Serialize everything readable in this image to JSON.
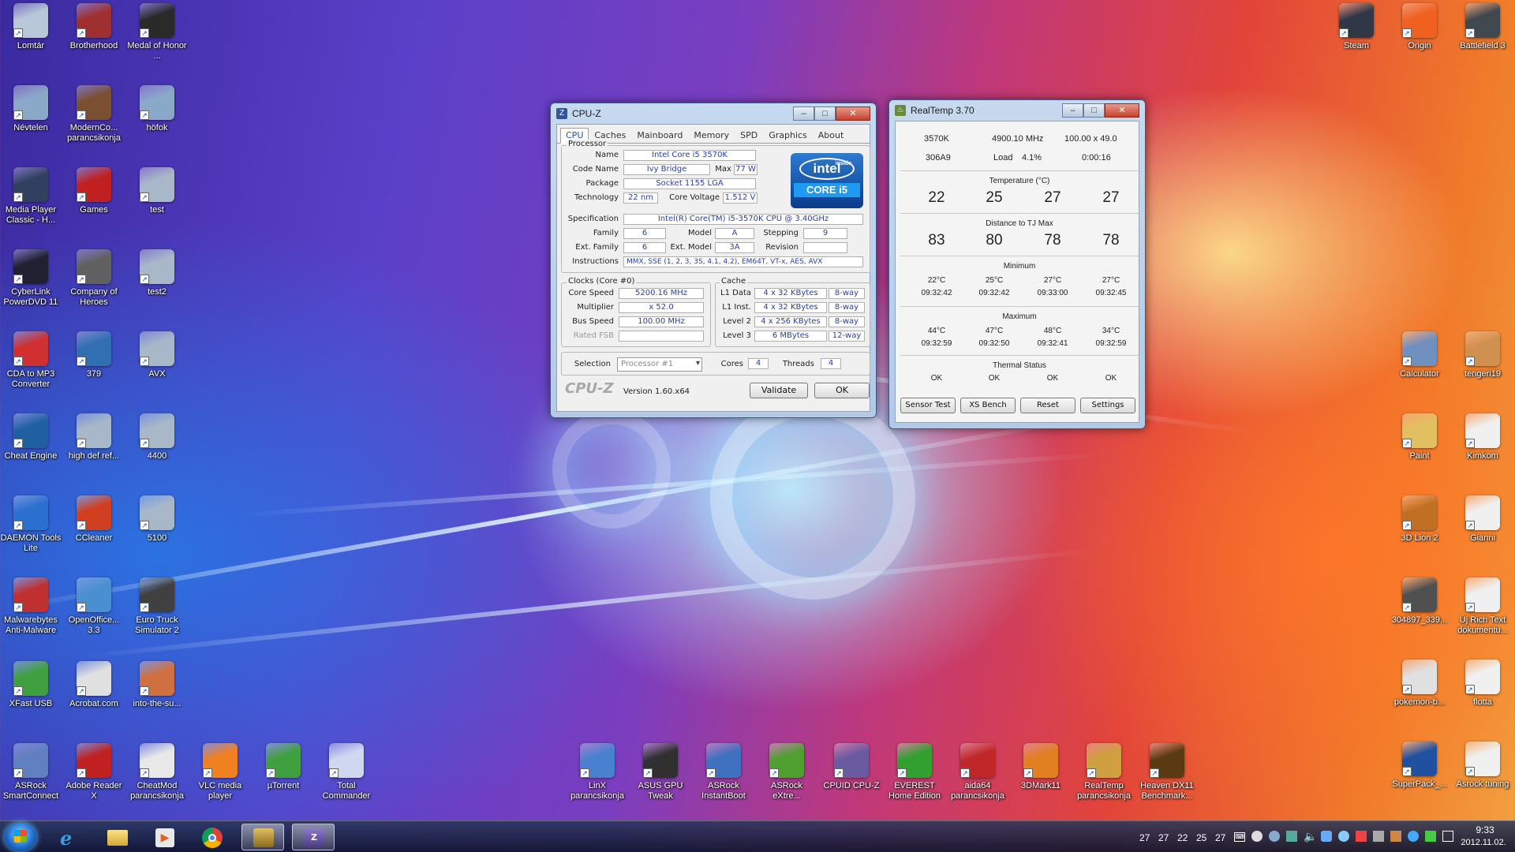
{
  "desktop": {
    "icons_left": [
      {
        "label": "Lomtár",
        "icon": "recycle-bin-icon",
        "color": "#b8c8d8"
      },
      {
        "label": "Brotherhood",
        "icon": "game-icon",
        "color": "#a03030"
      },
      {
        "label": "Medal of Honor ...",
        "icon": "medal-of-honor-icon",
        "color": "#2a2a2a"
      },
      {
        "label": "Névtelen",
        "icon": "image-file-icon",
        "color": "#8aa8c8"
      },
      {
        "label": "ModernCo... parancsikonja",
        "icon": "game-icon",
        "color": "#7a5030"
      },
      {
        "label": "höfok",
        "icon": "image-file-icon",
        "color": "#8aa8c8"
      },
      {
        "label": "Media Player Classic - H...",
        "icon": "media-player-icon",
        "color": "#304060"
      },
      {
        "label": "Games",
        "icon": "games-icon",
        "color": "#c02020"
      },
      {
        "label": "test",
        "icon": "image-file-icon",
        "color": "#a8b8c8"
      },
      {
        "label": "CyberLink PowerDVD 11",
        "icon": "powerdvd-icon",
        "color": "#202030"
      },
      {
        "label": "Company of Heroes",
        "icon": "game-icon",
        "color": "#606060"
      },
      {
        "label": "test2",
        "icon": "image-file-icon",
        "color": "#a8b8c8"
      },
      {
        "label": "CDA to MP3 Converter",
        "icon": "audio-converter-icon",
        "color": "#d03030"
      },
      {
        "label": "379",
        "icon": "image-file-icon",
        "color": "#3070b0"
      },
      {
        "label": "AVX",
        "icon": "image-file-icon",
        "color": "#a8b8c8"
      },
      {
        "label": "Cheat Engine",
        "icon": "cheat-engine-icon",
        "color": "#2060a0"
      },
      {
        "label": "high def ref...",
        "icon": "image-file-icon",
        "color": "#a8b8c8"
      },
      {
        "label": "4400",
        "icon": "image-file-icon",
        "color": "#a8b8c8"
      },
      {
        "label": "DAEMON Tools Lite",
        "icon": "daemon-tools-icon",
        "color": "#2a70d0"
      },
      {
        "label": "CCleaner",
        "icon": "ccleaner-icon",
        "color": "#d04020"
      },
      {
        "label": "5100",
        "icon": "image-file-icon",
        "color": "#a8b8c8"
      },
      {
        "label": "Malwarebytes Anti-Malware",
        "icon": "malwarebytes-icon",
        "color": "#c03030"
      },
      {
        "label": "OpenOffice... 3.3",
        "icon": "openoffice-icon",
        "color": "#4a90d0"
      },
      {
        "label": "Euro Truck Simulator 2",
        "icon": "truck-icon",
        "color": "#404040"
      },
      {
        "label": "XFast USB",
        "icon": "usb-icon",
        "color": "#40a040"
      },
      {
        "label": "Acrobat.com",
        "icon": "acrobat-icon",
        "color": "#e0e0e0"
      },
      {
        "label": "into-the-su...",
        "icon": "image-file-icon",
        "color": "#d07040"
      },
      {
        "label": "ASRock SmartConnect",
        "icon": "asrock-icon",
        "color": "#6080c0"
      },
      {
        "label": "Adobe Reader X",
        "icon": "adobe-reader-icon",
        "color": "#c02020"
      },
      {
        "label": "CheatMod parancsikonja",
        "icon": "document-icon",
        "color": "#e8e8e8"
      },
      {
        "label": "VLC media player",
        "icon": "vlc-icon",
        "color": "#f08020"
      },
      {
        "label": "µTorrent",
        "icon": "utorrent-icon",
        "color": "#40a040"
      },
      {
        "label": "Total Commander",
        "icon": "total-commander-icon",
        "color": "#d0d8f0"
      }
    ],
    "icons_bottom": [
      {
        "label": "LinX parancsikonja",
        "icon": "linx-icon",
        "color": "#4a80d0"
      },
      {
        "label": "ASUS GPU Tweak",
        "icon": "gpu-tweak-icon",
        "color": "#303030"
      },
      {
        "label": "ASRock InstantBoot",
        "icon": "asrock-icon",
        "color": "#4070c0"
      },
      {
        "label": "ASRock eXtre...",
        "icon": "asrock-icon",
        "color": "#50a030"
      },
      {
        "label": "CPUID CPU-Z",
        "icon": "cpuz-icon",
        "color": "#6a5aa0"
      },
      {
        "label": "EVEREST Home Edition",
        "icon": "everest-icon",
        "color": "#30a030"
      },
      {
        "label": "aida64 parancsikonja",
        "icon": "aida64-icon",
        "color": "#c02828"
      },
      {
        "label": "3DMark11",
        "icon": "3dmark-icon",
        "color": "#e08020"
      },
      {
        "label": "RealTemp parancsikonja",
        "icon": "realtemp-icon",
        "color": "#d0a040"
      },
      {
        "label": "Heaven DX11 Benchmark...",
        "icon": "heaven-icon",
        "color": "#5a3a10"
      }
    ],
    "icons_right_top": [
      {
        "label": "Steam",
        "icon": "steam-icon",
        "color": "#303848"
      },
      {
        "label": "Origin",
        "icon": "origin-icon",
        "color": "#f06020"
      },
      {
        "label": "Battlefield 3",
        "icon": "battlefield-icon",
        "color": "#404850"
      }
    ],
    "icons_right": [
      {
        "label": "Calculator",
        "icon": "calculator-icon",
        "color": "#7090c0"
      },
      {
        "label": "tengeri19",
        "icon": "image-file-icon",
        "color": "#d09050"
      },
      {
        "label": "Paint",
        "icon": "paint-icon",
        "color": "#e0c060"
      },
      {
        "label": "Kimkom",
        "icon": "text-file-icon",
        "color": "#f0f0f0"
      },
      {
        "label": "3D Lion 2",
        "icon": "image-file-icon",
        "color": "#c07020"
      },
      {
        "label": "Gianni",
        "icon": "text-file-icon",
        "color": "#f0f0f0"
      },
      {
        "label": "304897_339...",
        "icon": "image-file-icon",
        "color": "#505050"
      },
      {
        "label": "Új Rich Text dokumentu...",
        "icon": "text-file-icon",
        "color": "#f0f0f0"
      },
      {
        "label": "pokemon-b...",
        "icon": "image-file-icon",
        "color": "#e0e0e0"
      },
      {
        "label": "flotta",
        "icon": "text-file-icon",
        "color": "#f0f0f0"
      },
      {
        "label": "SuperPack_...",
        "icon": "image-file-icon",
        "color": "#2050a0"
      },
      {
        "label": "Asrock tuning",
        "icon": "text-file-icon",
        "color": "#f0f0f0"
      }
    ]
  },
  "cpuz": {
    "title": "CPU-Z",
    "tabs": [
      "CPU",
      "Caches",
      "Mainboard",
      "Memory",
      "SPD",
      "Graphics",
      "About"
    ],
    "processor_group": "Processor",
    "name_label": "Name",
    "name": "Intel Core i5 3570K",
    "codename_label": "Code Name",
    "codename": "Ivy Bridge",
    "maxtdp_label": "Max TDP",
    "maxtdp": "77 W",
    "package_label": "Package",
    "package": "Socket 1155 LGA",
    "technology_label": "Technology",
    "technology": "22 nm",
    "corevoltage_label": "Core Voltage",
    "corevoltage": "1.512 V",
    "spec_label": "Specification",
    "spec": "Intel(R) Core(TM) i5-3570K CPU @ 3.40GHz",
    "family_label": "Family",
    "family": "6",
    "model_label": "Model",
    "model": "A",
    "stepping_label": "Stepping",
    "stepping": "9",
    "extfamily_label": "Ext. Family",
    "extfamily": "6",
    "extmodel_label": "Ext. Model",
    "extmodel": "3A",
    "revision_label": "Revision",
    "revision": "",
    "instructions_label": "Instructions",
    "instructions": "MMX, SSE (1, 2, 3, 3S, 4.1, 4.2), EM64T, VT-x, AES, AVX",
    "logo_top": "intel",
    "logo_inside": "inside",
    "logo_bottom": "CORE i5",
    "clocks_group": "Clocks (Core #0)",
    "corespeed_label": "Core Speed",
    "corespeed": "5200.16 MHz",
    "multiplier_label": "Multiplier",
    "multiplier": "x 52.0",
    "busspeed_label": "Bus Speed",
    "busspeed": "100.00 MHz",
    "ratedfsb_label": "Rated FSB",
    "ratedfsb": "",
    "cache_group": "Cache",
    "l1data_label": "L1 Data",
    "l1data": "4 x 32 KBytes",
    "l1data_way": "8-way",
    "l1inst_label": "L1 Inst.",
    "l1inst": "4 x 32 KBytes",
    "l1inst_way": "8-way",
    "l2_label": "Level 2",
    "l2": "4 x 256 KBytes",
    "l2_way": "8-way",
    "l3_label": "Level 3",
    "l3": "6 MBytes",
    "l3_way": "12-way",
    "selection_label": "Selection",
    "selection": "Processor #1",
    "cores_label": "Cores",
    "cores": "4",
    "threads_label": "Threads",
    "threads": "4",
    "brand": "CPU-Z",
    "version": "Version 1.60.x64",
    "validate": "Validate",
    "ok": "OK"
  },
  "realtemp": {
    "title": "RealTemp 3.70",
    "cpu": "3570K",
    "mhz": "4900.10 MHz",
    "multi": "100.00 x 49.0",
    "cpuid": "306A9",
    "load_label": "Load",
    "load": "4.1%",
    "time": "0:00:16",
    "temp_title": "Temperature (°C)",
    "temps": [
      "22",
      "25",
      "27",
      "27"
    ],
    "dist_title": "Distance to TJ Max",
    "dists": [
      "83",
      "80",
      "78",
      "78"
    ],
    "min_title": "Minimum",
    "mins": [
      "22°C",
      "25°C",
      "27°C",
      "27°C"
    ],
    "min_times": [
      "09:32:42",
      "09:32:42",
      "09:33:00",
      "09:32:45"
    ],
    "max_title": "Maximum",
    "maxs": [
      "44°C",
      "47°C",
      "48°C",
      "34°C"
    ],
    "max_times": [
      "09:32:59",
      "09:32:50",
      "09:32:41",
      "09:32:59"
    ],
    "thermal_title": "Thermal Status",
    "status": [
      "OK",
      "OK",
      "OK",
      "OK"
    ],
    "buttons": [
      "Sensor Test",
      "XS Bench",
      "Reset",
      "Settings"
    ]
  },
  "taskbar": {
    "tray_temps": [
      "27",
      "27",
      "22",
      "25",
      "27"
    ],
    "time": "9:33",
    "date": "2012.11.02."
  }
}
